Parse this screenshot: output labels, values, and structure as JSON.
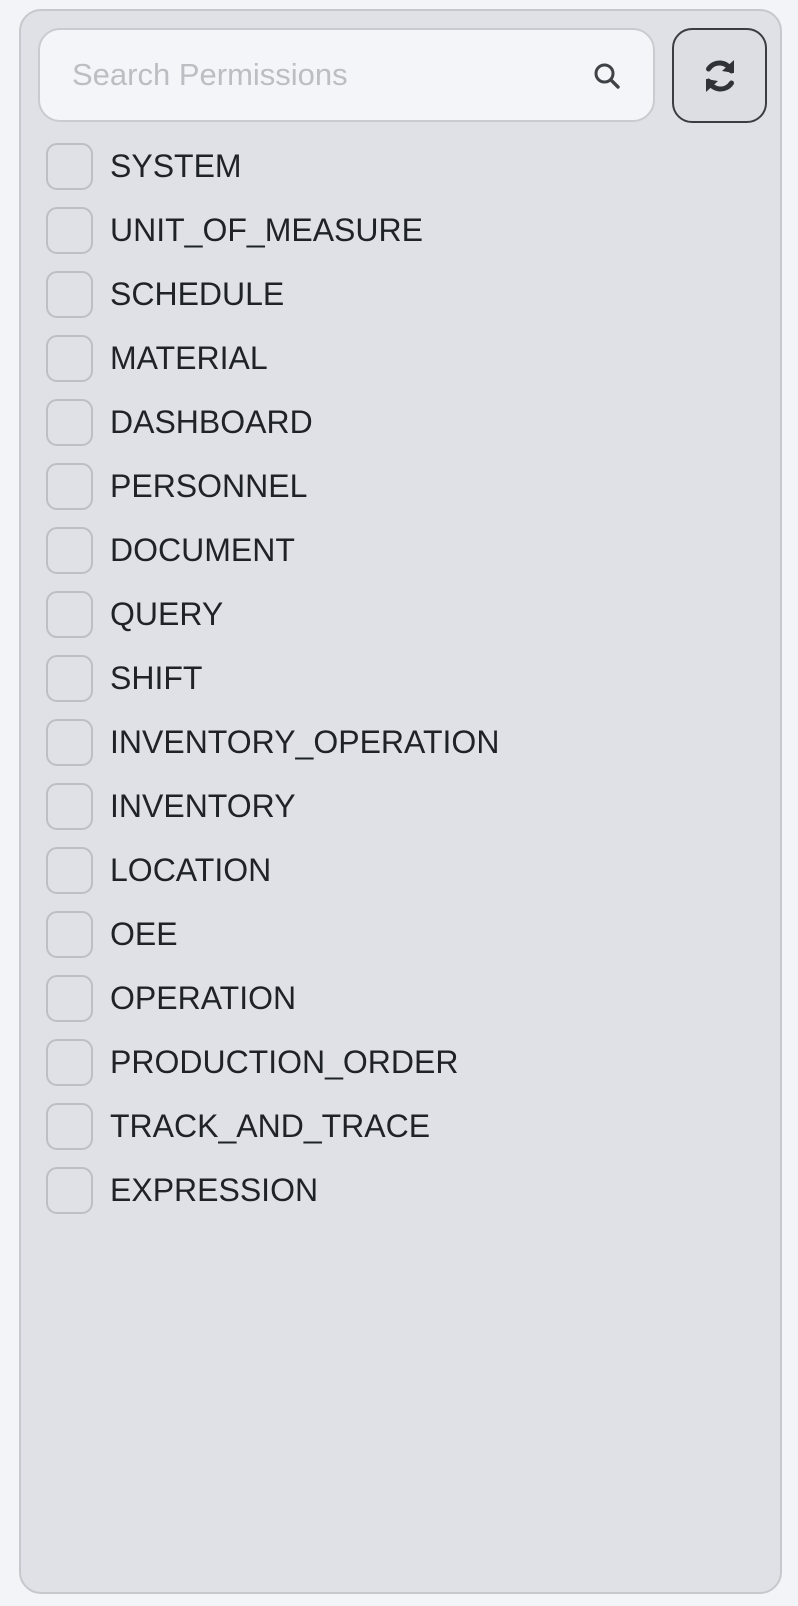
{
  "search": {
    "placeholder": "Search Permissions",
    "value": "",
    "icon": "search-icon"
  },
  "refresh_button": {
    "icon": "refresh-icon"
  },
  "permissions": [
    {
      "label": "SYSTEM",
      "checked": false
    },
    {
      "label": "UNIT_OF_MEASURE",
      "checked": false
    },
    {
      "label": "SCHEDULE",
      "checked": false
    },
    {
      "label": "MATERIAL",
      "checked": false
    },
    {
      "label": "DASHBOARD",
      "checked": false
    },
    {
      "label": "PERSONNEL",
      "checked": false
    },
    {
      "label": "DOCUMENT",
      "checked": false
    },
    {
      "label": "QUERY",
      "checked": false
    },
    {
      "label": "SHIFT",
      "checked": false
    },
    {
      "label": "INVENTORY_OPERATION",
      "checked": false
    },
    {
      "label": "INVENTORY",
      "checked": false
    },
    {
      "label": "LOCATION",
      "checked": false
    },
    {
      "label": "OEE",
      "checked": false
    },
    {
      "label": "OPERATION",
      "checked": false
    },
    {
      "label": "PRODUCTION_ORDER",
      "checked": false
    },
    {
      "label": "TRACK_AND_TRACE",
      "checked": false
    },
    {
      "label": "EXPRESSION",
      "checked": false
    }
  ],
  "colors": {
    "page_background": "#f2f4f8",
    "panel_background": "#dfe1e6",
    "text": "#1f2328",
    "placeholder": "#bcbec3"
  }
}
